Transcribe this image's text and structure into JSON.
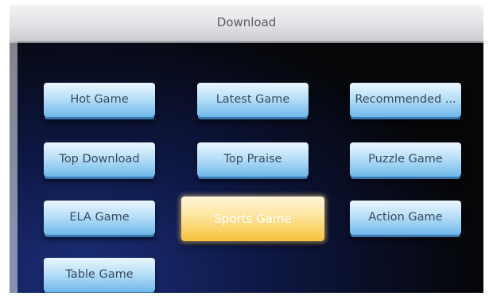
{
  "header": {
    "title": "Download"
  },
  "menu": {
    "items": [
      {
        "label": "Hot Game"
      },
      {
        "label": "Latest Game"
      },
      {
        "label": "Recommended ..."
      },
      {
        "label": "Top Download"
      },
      {
        "label": "Top Praise"
      },
      {
        "label": "Puzzle Game"
      },
      {
        "label": "ELA Game"
      },
      {
        "label": "Sports Game",
        "selected": true
      },
      {
        "label": "Action Game"
      },
      {
        "label": "Table Game"
      }
    ],
    "selected_color": "#f7c23c",
    "button_color": "#b9e0f8"
  }
}
